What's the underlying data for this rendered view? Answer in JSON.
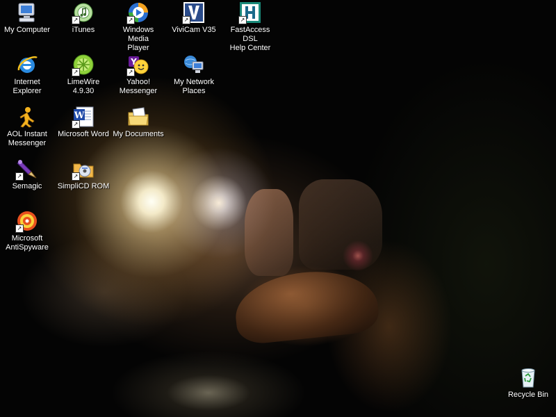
{
  "desktop": {
    "icons": [
      {
        "label": "My Computer",
        "icon": "my-computer-icon"
      },
      {
        "label": "iTunes",
        "icon": "itunes-icon"
      },
      {
        "label": "Windows Media\nPlayer",
        "icon": "windows-media-player-icon"
      },
      {
        "label": "ViviCam V35",
        "icon": "vivicam-icon"
      },
      {
        "label": "FastAccess DSL\nHelp Center",
        "icon": "fastaccess-dsl-icon"
      },
      {
        "label": "Internet\nExplorer",
        "icon": "internet-explorer-icon"
      },
      {
        "label": "LimeWire\n4.9.30",
        "icon": "limewire-icon"
      },
      {
        "label": "Yahoo!\nMessenger",
        "icon": "yahoo-messenger-icon"
      },
      {
        "label": "My Network\nPlaces",
        "icon": "my-network-places-icon"
      },
      {
        "label": "AOL Instant\nMessenger",
        "icon": "aol-instant-messenger-icon"
      },
      {
        "label": "Microsoft Word",
        "icon": "microsoft-word-icon"
      },
      {
        "label": "My Documents",
        "icon": "my-documents-icon"
      },
      {
        "label": "Semagic",
        "icon": "semagic-icon"
      },
      {
        "label": "SimpliCD ROM",
        "icon": "simplicd-rom-icon"
      },
      {
        "label": "Microsoft\nAntiSpyware",
        "icon": "microsoft-antispyware-icon"
      },
      {
        "label": "Recycle Bin",
        "icon": "recycle-bin-icon"
      }
    ]
  },
  "colors": {
    "label_text": "#ffffff",
    "wallpaper_base": "#040404"
  }
}
